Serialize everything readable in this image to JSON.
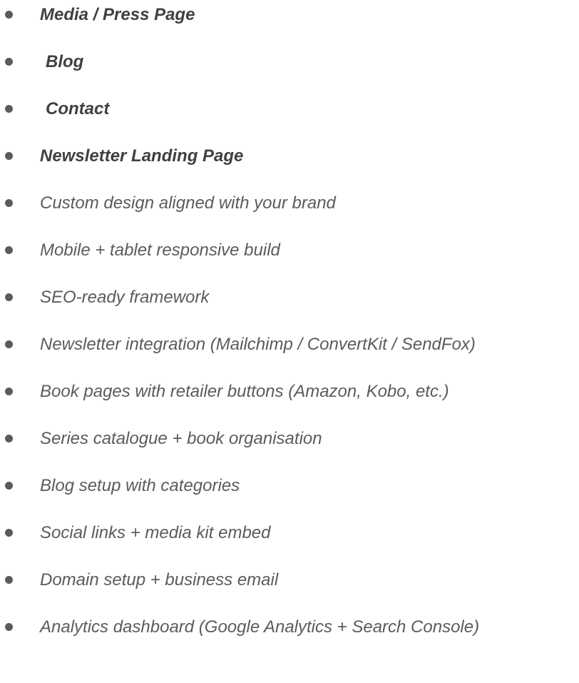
{
  "page_list": {
    "items": [
      {
        "label": "Media / Press Page"
      },
      {
        "label": "Blog"
      },
      {
        "label": "Contact"
      },
      {
        "label": "Newsletter Landing Page"
      },
      {
        "label": "Custom design aligned with your brand"
      },
      {
        "label": "Mobile + tablet responsive build"
      },
      {
        "label": "SEO-ready framework"
      },
      {
        "label": "Newsletter integration (Mailchimp / ConvertKit / SendFox)"
      },
      {
        "label": "Book pages with retailer buttons (Amazon, Kobo, etc.)"
      },
      {
        "label": "Series catalogue + book organisation"
      },
      {
        "label": "Blog setup with categories"
      },
      {
        "label": "Social links + media kit embed"
      },
      {
        "label": "Domain setup + business email"
      },
      {
        "label": "Analytics dashboard (Google Analytics + Search Console)"
      }
    ]
  },
  "colors": {
    "text": "#5b5b5b",
    "bold_text": "#404040",
    "background": "#ffffff"
  }
}
